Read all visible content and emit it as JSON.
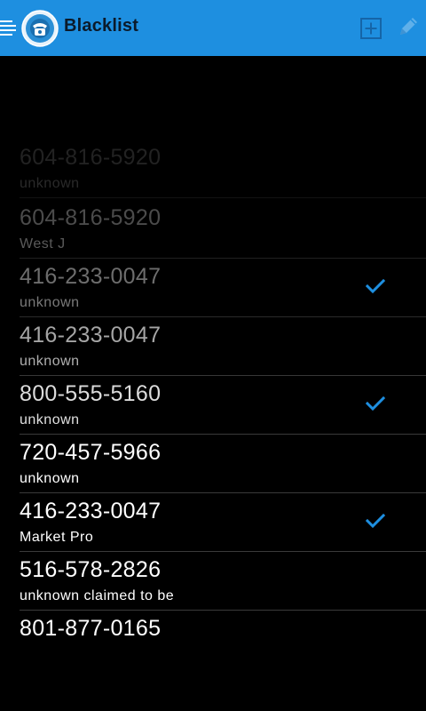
{
  "header": {
    "title": "Blacklist",
    "accent_color": "#1e8fe0",
    "logo_text": "BLACKLIST"
  },
  "rows": [
    {
      "number": "604-816-5920",
      "name": "unknown",
      "checked": false
    },
    {
      "number": "604-816-5920",
      "name": "West J",
      "checked": false
    },
    {
      "number": "416-233-0047",
      "name": "unknown",
      "checked": true
    },
    {
      "number": "416-233-0047",
      "name": "unknown",
      "checked": false
    },
    {
      "number": "800-555-5160",
      "name": "unknown",
      "checked": true
    },
    {
      "number": "720-457-5966",
      "name": "unknown",
      "checked": false
    },
    {
      "number": "416-233-0047",
      "name": "Market Pro",
      "checked": true
    },
    {
      "number": "516-578-2826",
      "name": "unknown claimed to be",
      "checked": false
    },
    {
      "number": "801-877-0165",
      "name": "",
      "checked": false
    }
  ],
  "check_color": "#1e8fe0"
}
